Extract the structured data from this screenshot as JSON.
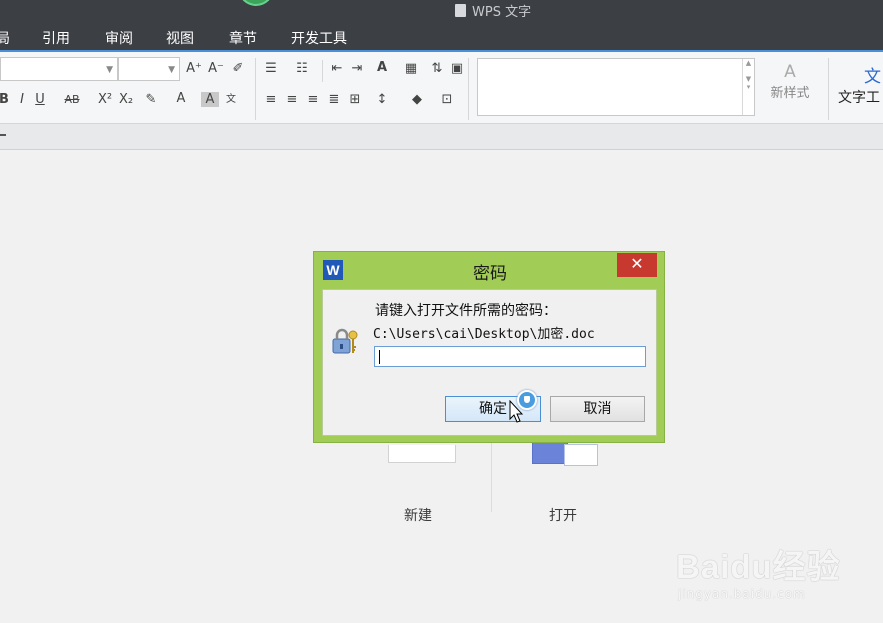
{
  "window": {
    "title": "WPS 文字"
  },
  "menu": {
    "items": [
      {
        "label": "局"
      },
      {
        "label": "引用"
      },
      {
        "label": "审阅"
      },
      {
        "label": "视图"
      },
      {
        "label": "章节"
      },
      {
        "label": "开发工具"
      }
    ]
  },
  "ribbon": {
    "new_style_label": "新样式",
    "text_tool_label": "文字工"
  },
  "start": {
    "new_label": "新建",
    "open_label": "打开"
  },
  "dialog": {
    "title": "密码",
    "logo_letter": "W",
    "close_glyph": "✕",
    "prompt": "请键入打开文件所需的密码：",
    "file_path": "C:\\Users\\cai\\Desktop\\加密.doc",
    "password_value": "",
    "ok_label": "确定",
    "cancel_label": "取消"
  },
  "watermark": {
    "brand": "Baidu经验",
    "url": "jingyan.baidu.com"
  },
  "colors": {
    "titlebar": "#3c3f44",
    "dialog_frame": "#a1cc55",
    "close_red": "#c7382f",
    "accent_blue": "#4a90d9"
  }
}
